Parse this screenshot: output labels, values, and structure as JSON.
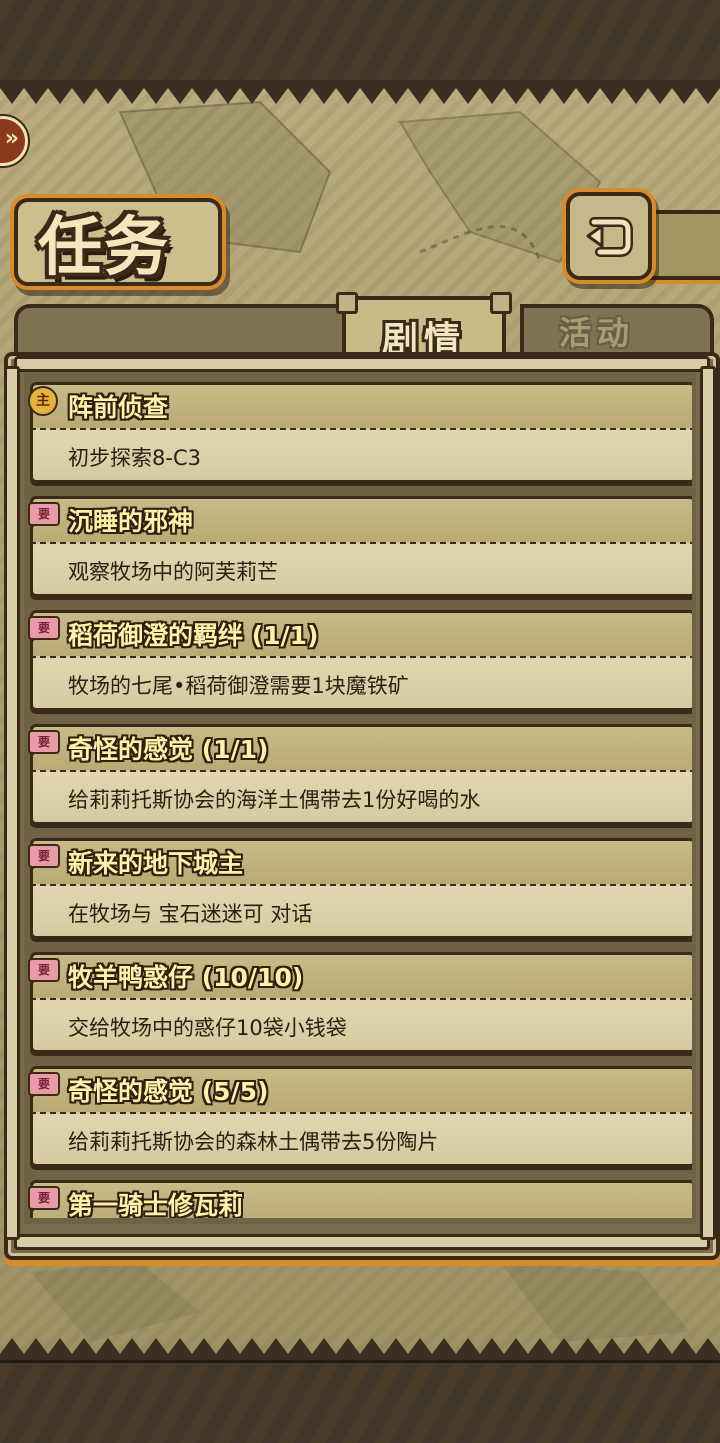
{
  "screen": {
    "title": "任务",
    "tabs": [
      {
        "label": "剧情",
        "active": true
      },
      {
        "label": "活动",
        "active": false
      }
    ],
    "back_arrow_glyph": "»",
    "return_icon": "return-arrow-icon"
  },
  "colors": {
    "frame": "#3b2a18",
    "accent_orange": "#d98a2b",
    "quest_title": "#fff1a8",
    "main_badge": "#e8b23a",
    "side_badge": "#e99aa7"
  },
  "quests": [
    {
      "type": "main",
      "badge": "主",
      "name": "阵前侦查",
      "desc": "初步探索8-C3"
    },
    {
      "type": "side",
      "badge": "要",
      "name": "沉睡的邪神",
      "desc": "观察牧场中的阿芙莉芒"
    },
    {
      "type": "side",
      "badge": "要",
      "name": "稻荷御澄的羁绊 (1/1)",
      "desc": "牧场的七尾•稻荷御澄需要1块魔铁矿"
    },
    {
      "type": "side",
      "badge": "要",
      "name": "奇怪的感觉 (1/1)",
      "desc": "给莉莉托斯协会的海洋土偶带去1份好喝的水"
    },
    {
      "type": "side",
      "badge": "要",
      "name": "新来的地下城主",
      "desc": "在牧场与 宝石迷迷可 对话"
    },
    {
      "type": "side",
      "badge": "要",
      "name": "牧羊鸭惑仔 (10/10)",
      "desc": "交给牧场中的惑仔10袋小钱袋"
    },
    {
      "type": "side",
      "badge": "要",
      "name": "奇怪的感觉 (5/5)",
      "desc": "给莉莉托斯协会的森林土偶带去5份陶片"
    },
    {
      "type": "side",
      "badge": "要",
      "name": "第一骑士修瓦莉",
      "desc": ""
    }
  ]
}
